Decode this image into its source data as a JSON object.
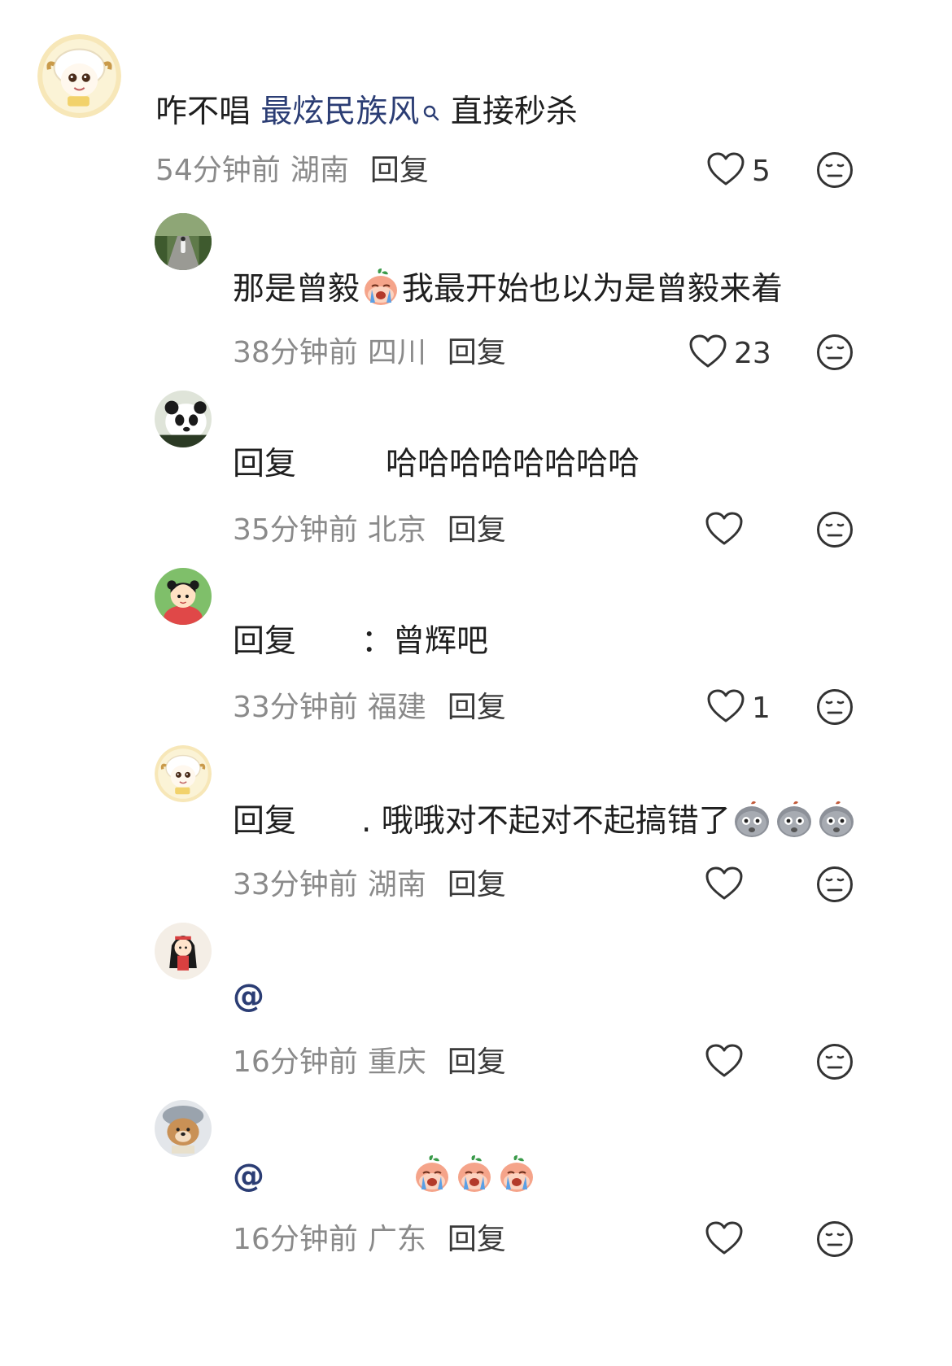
{
  "comments": [
    {
      "level": "top",
      "segments": [
        {
          "kind": "text",
          "value": "咋不唱 "
        },
        {
          "kind": "link",
          "value": "最炫民族风"
        },
        {
          "kind": "text",
          "value": " 直接秒杀"
        }
      ],
      "time": "54分钟前",
      "location": "湖南",
      "reply_label": "回复",
      "likes": "5",
      "avatar": "sheep-avatar"
    },
    {
      "level": "reply",
      "segments": [
        {
          "kind": "text",
          "value": "那是曾毅"
        },
        {
          "kind": "emoji",
          "value": "crying-peach-emoji"
        },
        {
          "kind": "text",
          "value": "我最开始也以为是曾毅来着"
        }
      ],
      "time": "38分钟前",
      "location": "四川",
      "reply_label": "回复",
      "likes": "23",
      "avatar": "road-photo-avatar"
    },
    {
      "level": "reply",
      "segments": [
        {
          "kind": "text",
          "value": "回复"
        },
        {
          "kind": "gap",
          "value": ""
        },
        {
          "kind": "text",
          "value": "哈哈哈哈哈哈哈哈"
        }
      ],
      "time": "35分钟前",
      "location": "北京",
      "reply_label": "回复",
      "likes": "",
      "avatar": "panda-avatar"
    },
    {
      "level": "reply",
      "segments": [
        {
          "kind": "text",
          "value": "回复"
        },
        {
          "kind": "gap",
          "value": ""
        },
        {
          "kind": "text",
          "value": "：曾辉吧"
        }
      ],
      "time": "33分钟前",
      "location": "福建",
      "reply_label": "回复",
      "likes": "1",
      "avatar": "girl-cartoon-avatar"
    },
    {
      "level": "reply",
      "segments": [
        {
          "kind": "text",
          "value": "回复"
        },
        {
          "kind": "gap",
          "value": ""
        },
        {
          "kind": "text",
          "value": ". 哦哦对不起对不起搞错了"
        },
        {
          "kind": "emoji",
          "value": "gray-potato-emoji"
        },
        {
          "kind": "emoji",
          "value": "gray-potato-emoji"
        },
        {
          "kind": "emoji",
          "value": "gray-potato-emoji"
        }
      ],
      "time": "33分钟前",
      "location": "湖南",
      "reply_label": "回复",
      "likes": "",
      "avatar": "sheep-avatar"
    },
    {
      "level": "reply",
      "segments": [
        {
          "kind": "mention",
          "value": "@"
        }
      ],
      "time": "16分钟前",
      "location": "重庆",
      "reply_label": "回复",
      "likes": "",
      "avatar": "doll-avatar"
    },
    {
      "level": "reply",
      "segments": [
        {
          "kind": "mention",
          "value": "@"
        },
        {
          "kind": "gap",
          "value": ""
        },
        {
          "kind": "emoji",
          "value": "crying-peach-emoji"
        },
        {
          "kind": "emoji",
          "value": "crying-peach-emoji"
        },
        {
          "kind": "emoji",
          "value": "crying-peach-emoji"
        }
      ],
      "time": "16分钟前",
      "location": "广东",
      "reply_label": "回复",
      "likes": "",
      "avatar": "dog-avatar"
    }
  ],
  "colors": {
    "link": "#2b3d74",
    "meta": "#8a8a8a",
    "text": "#1f1f1f"
  }
}
